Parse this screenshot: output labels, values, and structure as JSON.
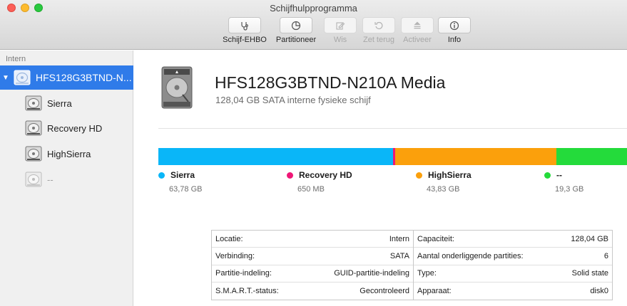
{
  "window": {
    "title": "Schijfhulpprogramma"
  },
  "toolbar": {
    "items": [
      {
        "label": "Schijf-EHBO",
        "icon": "stethoscope-icon",
        "enabled": true
      },
      {
        "label": "Partitioneer",
        "icon": "pie-icon",
        "enabled": true
      },
      {
        "label": "Wis",
        "icon": "erase-icon",
        "enabled": false
      },
      {
        "label": "Zet terug",
        "icon": "restore-icon",
        "enabled": false
      },
      {
        "label": "Activeer",
        "icon": "eject-icon",
        "enabled": false
      },
      {
        "label": "Info",
        "icon": "info-icon",
        "enabled": true
      }
    ]
  },
  "sidebar": {
    "section": "Intern",
    "items": [
      {
        "label": "HFS128G3BTND-N...",
        "selected": true
      },
      {
        "label": "Sierra"
      },
      {
        "label": "Recovery HD"
      },
      {
        "label": "HighSierra"
      },
      {
        "label": "--",
        "dimmed": true
      }
    ]
  },
  "disk": {
    "title": "HFS128G3BTND-N210A Media",
    "subtitle": "128,04 GB SATA interne fysieke schijf"
  },
  "partitions": [
    {
      "name": "Sierra",
      "size": "63,78 GB",
      "gb": 63.78,
      "color": "#0ab6f8"
    },
    {
      "name": "Recovery HD",
      "size": "650 MB",
      "gb": 0.65,
      "color": "#ef1777"
    },
    {
      "name": "HighSierra",
      "size": "43,83 GB",
      "gb": 43.83,
      "color": "#fba00c"
    },
    {
      "name": "--",
      "size": "19,3 GB",
      "gb": 19.3,
      "color": "#24db3b"
    }
  ],
  "info": {
    "left": [
      {
        "label": "Locatie:",
        "value": "Intern"
      },
      {
        "label": "Verbinding:",
        "value": "SATA"
      },
      {
        "label": "Partitie-indeling:",
        "value": "GUID-partitie-indeling"
      },
      {
        "label": "S.M.A.R.T.-status:",
        "value": "Gecontroleerd"
      }
    ],
    "right": [
      {
        "label": "Capaciteit:",
        "value": "128,04 GB"
      },
      {
        "label": "Aantal onderliggende partities:",
        "value": "6"
      },
      {
        "label": "Type:",
        "value": "Solid state"
      },
      {
        "label": "Apparaat:",
        "value": "disk0"
      }
    ]
  }
}
